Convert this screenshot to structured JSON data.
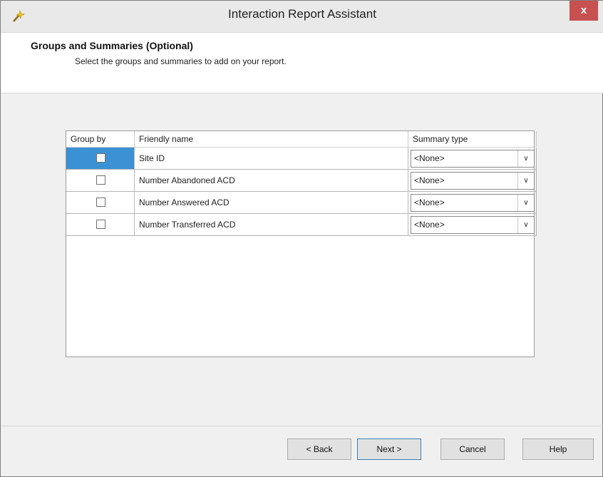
{
  "window": {
    "title": "Interaction Report Assistant",
    "close_glyph": "x"
  },
  "header": {
    "title": "Groups and Summaries (Optional)",
    "subtitle": "Select the groups and summaries to add on your report."
  },
  "grid": {
    "columns": {
      "group_by": "Group by",
      "friendly_name": "Friendly name",
      "summary_type": "Summary type"
    },
    "rows": [
      {
        "name": "Site ID",
        "summary": "<None>",
        "checked": false
      },
      {
        "name": "Number Abandoned ACD",
        "summary": "<None>",
        "checked": false
      },
      {
        "name": "Number Answered ACD",
        "summary": "<None>",
        "checked": false
      },
      {
        "name": "Number Transferred ACD",
        "summary": "<None>",
        "checked": false
      }
    ],
    "dropdown_glyph": "∨"
  },
  "buttons": {
    "back": "< Back",
    "next": "Next >",
    "cancel": "Cancel",
    "help": "Help"
  },
  "colors": {
    "selection": "#3b91d4",
    "close": "#c75050"
  }
}
